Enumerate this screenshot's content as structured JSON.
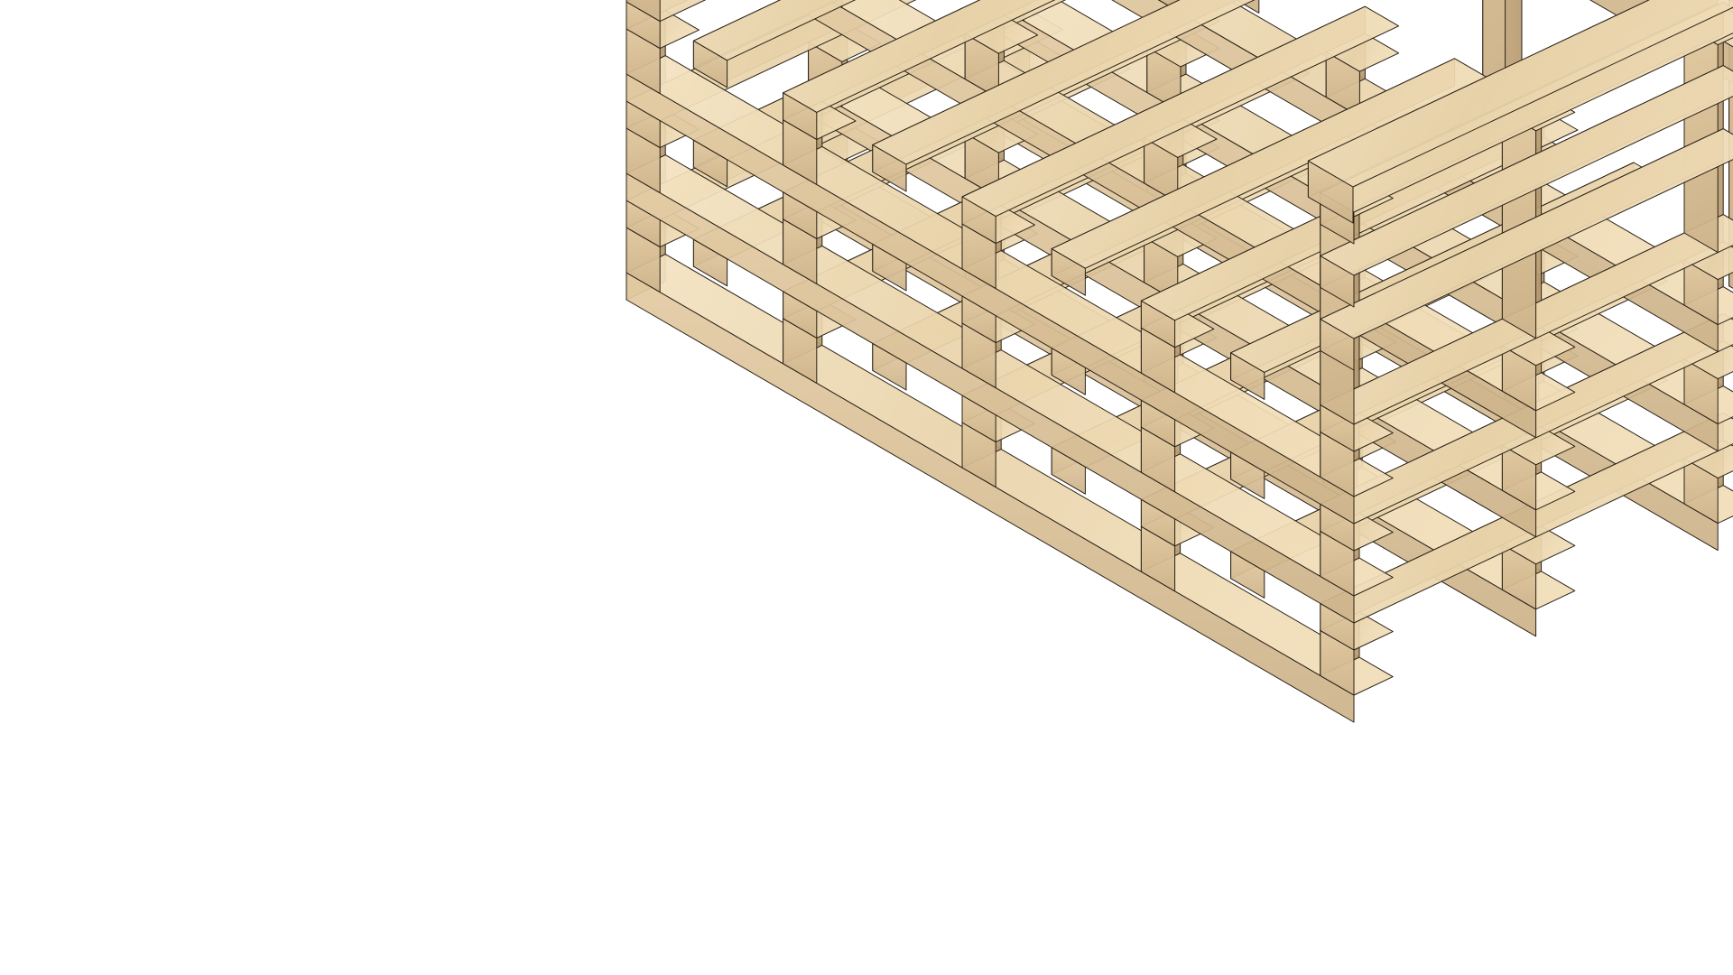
{
  "scene": {
    "subject": "pallet-sofa-wireframe-render",
    "background_color": "#ffffff",
    "colors": {
      "wood_top": "#eedcb8",
      "wood_front": "#d9c29c",
      "wood_side": "#c4a97e",
      "wood_dark": "#8a7351",
      "shadow": "#6b5a44",
      "edge": "#2a2217"
    }
  }
}
